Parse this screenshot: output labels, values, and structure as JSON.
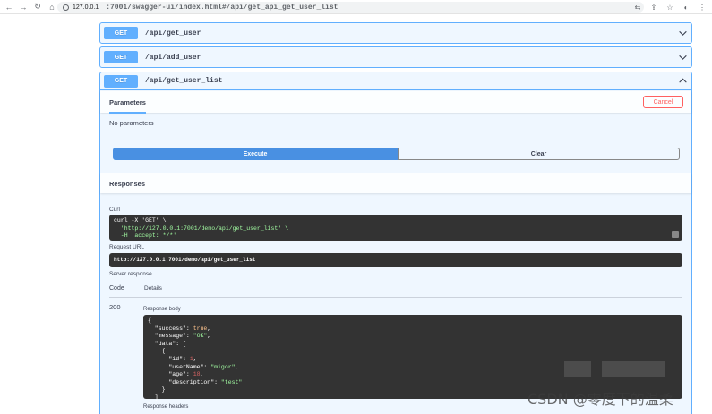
{
  "browser": {
    "url_host": "127.0.0.1",
    "url_rest": ":7001/swagger-ui/index.html#/api/get_api_get_user_list"
  },
  "operations": [
    {
      "method": "GET",
      "path": "/api/get_user"
    },
    {
      "method": "GET",
      "path": "/api/add_user"
    },
    {
      "method": "GET",
      "path": "/api/get_user_list"
    }
  ],
  "expanded": {
    "parameters_tab": "Parameters",
    "cancel_label": "Cancel",
    "no_params": "No parameters",
    "execute_label": "Execute",
    "clear_label": "Clear",
    "responses_title": "Responses",
    "curl_label": "Curl",
    "curl_lines": [
      "curl -X 'GET' \\",
      "  'http://127.0.0.1:7001/demo/api/get_user_list' \\",
      "  -H 'accept: */*'"
    ],
    "request_url_label": "Request URL",
    "request_url": "http://127.0.0.1:7001/demo/api/get_user_list",
    "server_response_label": "Server response",
    "col_code": "Code",
    "col_details": "Details",
    "response_code": "200",
    "response_body_label": "Response body",
    "response_body": {
      "success": "true",
      "message": "\"OK\"",
      "id": "1",
      "userName": "\"migor\"",
      "age": "18",
      "description": "\"test\""
    },
    "response_headers_label": "Response headers"
  },
  "watermark": "CSDN @零度下的温柔"
}
